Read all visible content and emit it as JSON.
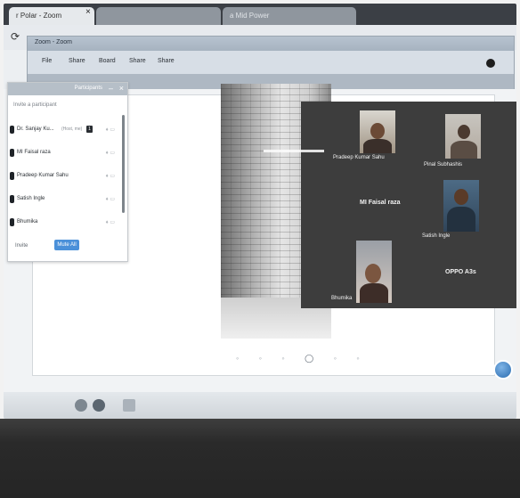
{
  "browser": {
    "tab_active_label": "r Polar - Zoom",
    "tab_close": "×",
    "tab_other_label": "",
    "tab_other_2": "a Mid Power"
  },
  "app": {
    "title": "Zoom - Zoom",
    "toolbar": [
      "File",
      "Share",
      "Board",
      "Share",
      "Share"
    ]
  },
  "participants_panel": {
    "title": "Participants",
    "search_placeholder": "Invite a participant",
    "participants": [
      {
        "name": "Dr. Sanjay Ku...",
        "role": "(Host, me)",
        "badge": "1"
      },
      {
        "name": "MI Faisal raza",
        "role": "",
        "badge": ""
      },
      {
        "name": "Pradeep Kumar Sahu",
        "role": "",
        "badge": ""
      },
      {
        "name": "Satish Ingle",
        "role": "",
        "badge": ""
      },
      {
        "name": "Bhumika",
        "role": "",
        "badge": ""
      }
    ],
    "footer_left": "Invite",
    "footer_button": "Mute All"
  },
  "gallery": {
    "tiles": [
      {
        "name": "Pradeep Kumar Sahu",
        "has_video": true
      },
      {
        "name": "Pinal Subhashis",
        "has_video": true
      },
      {
        "name": "MI Faisal raza",
        "has_video": false
      },
      {
        "name": "Satish Ingle",
        "has_video": true
      },
      {
        "name": "Bhumika",
        "has_video": true
      },
      {
        "name": "OPPO A3s",
        "has_video": false
      }
    ]
  },
  "presentation": {
    "page_nav_left": "◦ ◦ ◦",
    "page_nav_mid": "◯",
    "page_nav_right": "◦ ◦"
  }
}
